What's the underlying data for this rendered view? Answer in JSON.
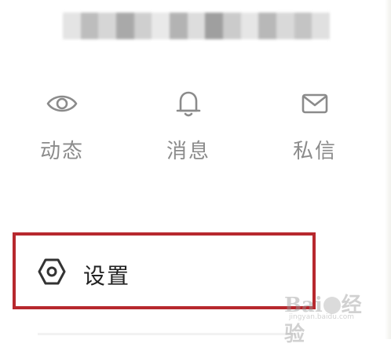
{
  "quick_actions": [
    {
      "label": "动态",
      "icon": "eye-icon"
    },
    {
      "label": "消息",
      "icon": "bell-icon"
    },
    {
      "label": "私信",
      "icon": "mail-icon"
    }
  ],
  "settings": {
    "label": "设置",
    "icon": "settings-hexagon-icon",
    "highlight_color": "#b7282e"
  },
  "watermark": {
    "text_left": "Bai",
    "text_right": "经验",
    "url": "jingyan.baidu.com"
  }
}
